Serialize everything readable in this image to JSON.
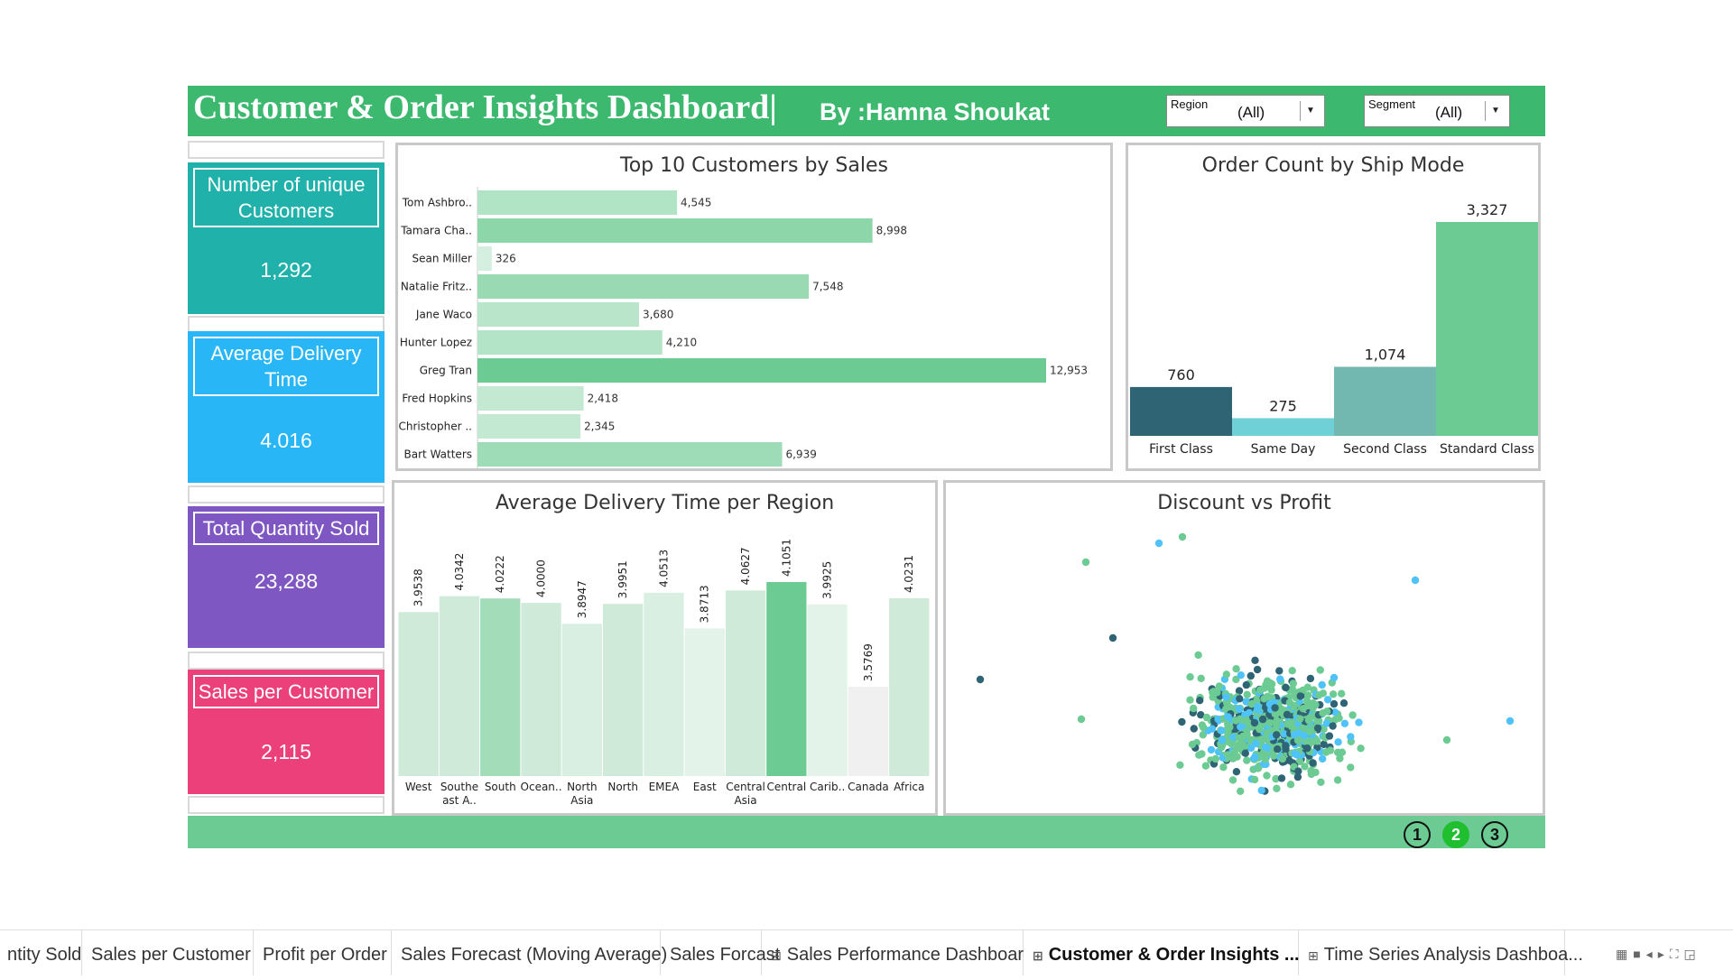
{
  "header": {
    "title": "Customer & Order Insights Dashboard|",
    "byline": "By :Hamna Shoukat",
    "filters": [
      {
        "label": "Region",
        "value": "(All)"
      },
      {
        "label": "Segment",
        "value": "(All)"
      }
    ]
  },
  "kpis": [
    {
      "label": "Number of unique Customers",
      "value": "1,292",
      "color": "#20b2aa"
    },
    {
      "label": "Average Delivery Time",
      "value": "4.016",
      "color": "#29b6f6"
    },
    {
      "label": "Total Quantity Sold",
      "value": "23,288",
      "color": "#7e57c2"
    },
    {
      "label": "Sales per Customer",
      "value": "2,115",
      "color": "#ec407a"
    }
  ],
  "top_customers": {
    "title": "Top 10 Customers by Sales",
    "labels": [
      "Tom Ashbro..",
      "Tamara Cha..",
      "Sean Miller",
      "Natalie Fritz..",
      "Jane Waco",
      "Hunter Lopez",
      "Greg Tran",
      "Fred Hopkins",
      "Christopher ..",
      "Bart Watters"
    ],
    "values": [
      4545,
      8998,
      326,
      7548,
      3680,
      4210,
      12953,
      2418,
      2345,
      6939
    ],
    "value_labels": [
      "4,545",
      "8,998",
      "326",
      "7,548",
      "3,680",
      "4,210",
      "12,953",
      "2,418",
      "2,345",
      "6,939"
    ]
  },
  "ship_mode": {
    "title": "Order Count by Ship Mode",
    "categories": [
      "First Class",
      "Same Day",
      "Second Class",
      "Standard Class"
    ],
    "values": [
      760,
      275,
      1074,
      3327
    ],
    "value_labels": [
      "760",
      "275",
      "1,074",
      "3,327"
    ],
    "colors": [
      "#2f6475",
      "#6fd0d6",
      "#72b7b0",
      "#6ccb92"
    ]
  },
  "delivery_region": {
    "title": "Average Delivery Time per Region",
    "categories": [
      "West",
      "Southe ast A..",
      "South",
      "Ocean..",
      "North Asia",
      "North",
      "EMEA",
      "East",
      "Central Asia",
      "Central",
      "Carib..",
      "Canada",
      "Africa"
    ],
    "values": [
      3.9538,
      4.0342,
      4.0222,
      4.0,
      3.8947,
      3.9951,
      4.0513,
      3.8713,
      4.0627,
      4.1051,
      3.9925,
      3.5769,
      4.0231
    ],
    "value_labels": [
      "3.9538",
      "4.0342",
      "4.0222",
      "4.0000",
      "3.8947",
      "3.9951",
      "4.0513",
      "3.8713",
      "4.0627",
      "4.1051",
      "3.9925",
      "3.5769",
      "4.0231"
    ]
  },
  "scatter": {
    "title": "Discount vs Profit",
    "colors": [
      "#6ccb92",
      "#4fc3f7",
      "#2f6475"
    ]
  },
  "pagination": [
    "1",
    "2",
    "3"
  ],
  "tabs": [
    {
      "label": "ntity Sold",
      "icon": false,
      "active": false
    },
    {
      "label": "Sales per Customer",
      "icon": false,
      "active": false
    },
    {
      "label": "Profit per Order",
      "icon": false,
      "active": false
    },
    {
      "label": "Sales Forecast (Moving Average)",
      "icon": false,
      "active": false
    },
    {
      "label": "Sales Forcast",
      "icon": false,
      "active": false
    },
    {
      "label": "Sales Performance Dashboard",
      "icon": true,
      "active": false
    },
    {
      "label": "Customer & Order Insights ...",
      "icon": true,
      "active": true
    },
    {
      "label": "Time Series Analysis Dashboa...",
      "icon": true,
      "active": false
    }
  ]
}
